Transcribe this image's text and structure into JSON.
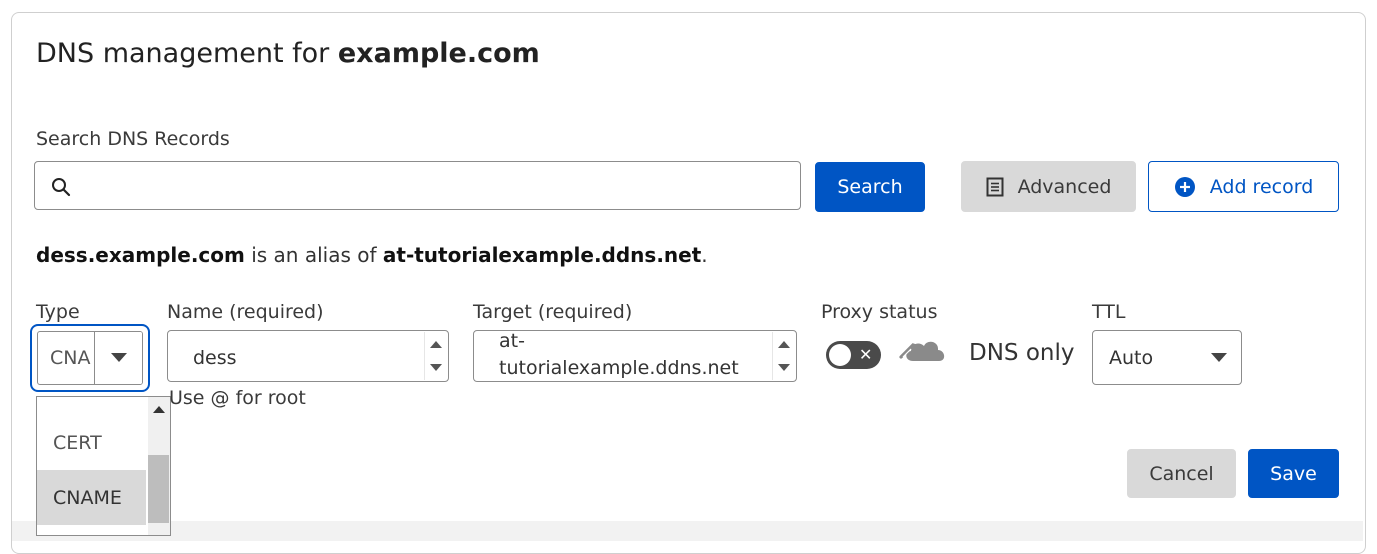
{
  "title": {
    "prefix": "DNS management for ",
    "domain": "example.com"
  },
  "search": {
    "label": "Search DNS Records",
    "value": "",
    "placeholder": "",
    "button_label": "Search"
  },
  "toolbar": {
    "advanced_label": "Advanced",
    "add_record_label": "Add record"
  },
  "alias": {
    "host": "dess.example.com",
    "middle": " is an alias of ",
    "target": "at-tutorialexample.ddns.net",
    "end": "."
  },
  "form": {
    "type": {
      "label": "Type",
      "value": "CNA",
      "options": [
        "CERT",
        "CNAME"
      ],
      "selected": "CNAME"
    },
    "name": {
      "label": "Name (required)",
      "value": "dess",
      "hint": "Use @ for root"
    },
    "target": {
      "label": "Target (required)",
      "value_line1": "at-",
      "value_line2": "tutorialexample.ddns.net"
    },
    "proxy": {
      "label": "Proxy status",
      "state": "DNS only",
      "toggle_symbol": "✕"
    },
    "ttl": {
      "label": "TTL",
      "value": "Auto"
    }
  },
  "actions": {
    "cancel_label": "Cancel",
    "save_label": "Save"
  },
  "colors": {
    "primary": "#0055c4",
    "grey_button": "#d9d9d9",
    "toggle_off": "#4a4a4a",
    "cloud": "#8a8a8a"
  },
  "icons": {
    "search": "magnifier-icon",
    "advanced": "document-list-icon",
    "add": "plus-circle-icon",
    "proxy": "cloud-icon"
  }
}
